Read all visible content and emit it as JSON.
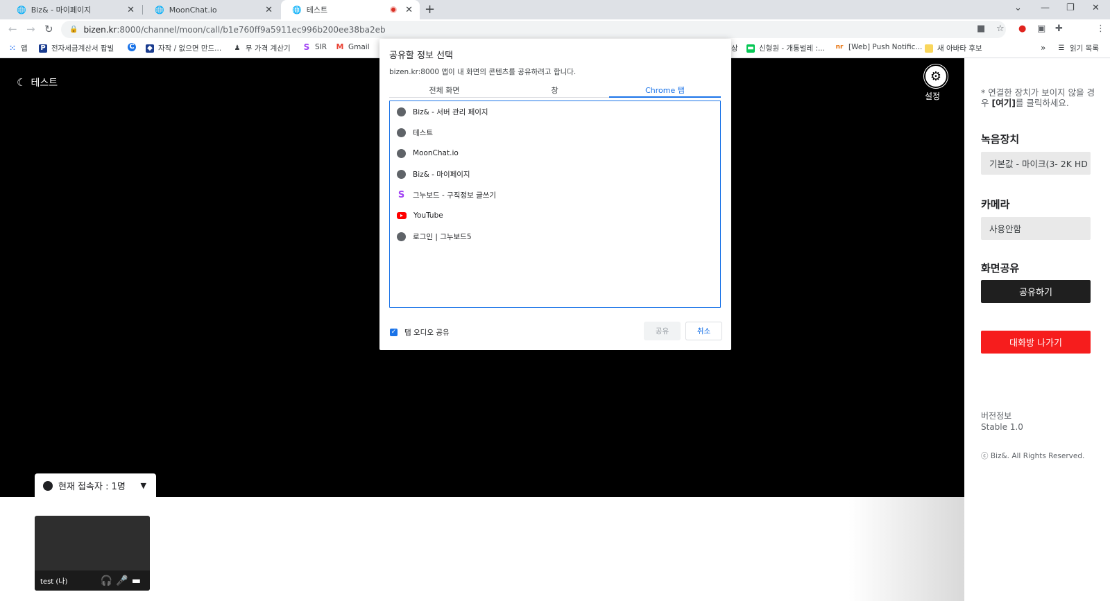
{
  "browser": {
    "tabs": [
      {
        "title": "Biz& - 마이페이지",
        "close": "✕"
      },
      {
        "title": "MoonChat.io",
        "close": "✕"
      },
      {
        "title": "테스트",
        "close": "✕"
      }
    ],
    "new_tab": "+",
    "window_controls": [
      "⌄",
      "—",
      "❐",
      "✕"
    ],
    "url_host": "bizen.kr",
    "url_rest": ":8000/channel/moon/call/b1e760ff9a5911ec996b200ee38ba2eb",
    "bookmarks": [
      {
        "label": "앱",
        "icon": "apps-icon"
      },
      {
        "label": "전자세금계산서 팝빌",
        "icon": "popbill-icon"
      },
      {
        "label": "",
        "icon": "blue-c-icon"
      },
      {
        "label": "자작 / 없으면 만드...",
        "icon": "cube-icon"
      },
      {
        "label": "무 가격 계산기",
        "icon": "person-icon"
      },
      {
        "label": "SIR",
        "icon": "sir-icon"
      },
      {
        "label": "Gmail",
        "icon": "gmail-icon"
      },
      {
        "label": "상",
        "icon": ""
      },
      {
        "label": "신형원 - 개통벌레 :...",
        "icon": "line-icon"
      },
      {
        "label": "[Web] Push Notific...",
        "icon": "nr-icon"
      },
      {
        "label": "새 아바타 후보",
        "icon": "folder-icon"
      }
    ],
    "bookmarks_more": "»",
    "reading_list": "읽기 목록"
  },
  "app": {
    "room_title": "테스트",
    "settings_label": "설정",
    "users_label": "현재 접속자 : 1명",
    "self_tile_name": "test (나)"
  },
  "panel": {
    "note_prefix": "* 연결한 장치가 보이지 않을 경우 ",
    "note_link": "[여기]",
    "note_suffix": "를 클릭하세요.",
    "audio_title": "녹음장치",
    "audio_value": "기본값 - 마이크(3- 2K HD",
    "camera_title": "카메라",
    "camera_value": "사용안함",
    "share_title": "화면공유",
    "share_button": "공유하기",
    "leave_button": "대화방 나가기",
    "version_label": "버전정보",
    "version_value": "Stable 1.0",
    "copyright": "ⓒ Biz&. All Rights Reserved."
  },
  "dialog": {
    "title": "공유할 정보 선택",
    "subtitle": "bizen.kr:8000 앱이 내 화면의 콘텐츠를 공유하려고 합니다.",
    "tabs": [
      "전체 화면",
      "창",
      "Chrome 탭"
    ],
    "active_tab": "Chrome 탭",
    "items": [
      {
        "title": "Biz& - 서버 관리 페이지",
        "icon": "globe-icon"
      },
      {
        "title": "테스트",
        "icon": "globe-icon"
      },
      {
        "title": "MoonChat.io",
        "icon": "globe-icon"
      },
      {
        "title": "Biz& - 마이페이지",
        "icon": "globe-icon"
      },
      {
        "title": "그누보드 - 구직정보 글쓰기",
        "icon": "sir-icon"
      },
      {
        "title": "YouTube",
        "icon": "youtube-icon"
      },
      {
        "title": "로그인 | 그누보드5",
        "icon": "globe-icon"
      }
    ],
    "audio_checkbox_label": "탭 오디오 공유",
    "audio_checked": true,
    "share_button": "공유",
    "cancel_button": "취소"
  },
  "colors": {
    "accent_blue": "#1a73e8",
    "leave_red": "#f61d1d",
    "stage_black": "#000000"
  }
}
